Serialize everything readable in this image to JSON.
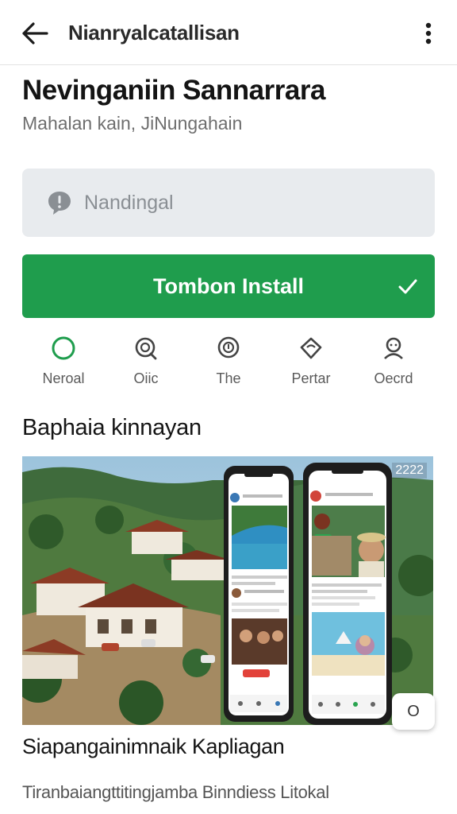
{
  "topbar": {
    "title": "Nianryalcatallisan",
    "back_icon": "arrow-left-icon",
    "more_icon": "more-vert-icon"
  },
  "app": {
    "name": "Nevinganiin Sannarrara",
    "subtitle": "Mahalan kain, JiNungahain"
  },
  "search": {
    "placeholder": "Nandingal",
    "icon": "chat-bubble-icon"
  },
  "install": {
    "label": "Tombon Install",
    "icon": "check-icon",
    "color": "#1f9d4d"
  },
  "actions": [
    {
      "label": "Neroal",
      "icon": "circle-icon",
      "color": "#1f9d4d"
    },
    {
      "label": "Oiic",
      "icon": "search-icon"
    },
    {
      "label": "The",
      "icon": "info-icon"
    },
    {
      "label": "Pertar",
      "icon": "heart-icon"
    },
    {
      "label": "Oecrd",
      "icon": "person-icon"
    }
  ],
  "section": {
    "title": "Baphaia kinnayan"
  },
  "screenshot": {
    "badge": "2222",
    "fab_label": "O"
  },
  "caption": {
    "title": "Siapangainimnaik Kapliagan",
    "description": "Tiranbaiangttitingjamba Binndiess Litokal"
  }
}
